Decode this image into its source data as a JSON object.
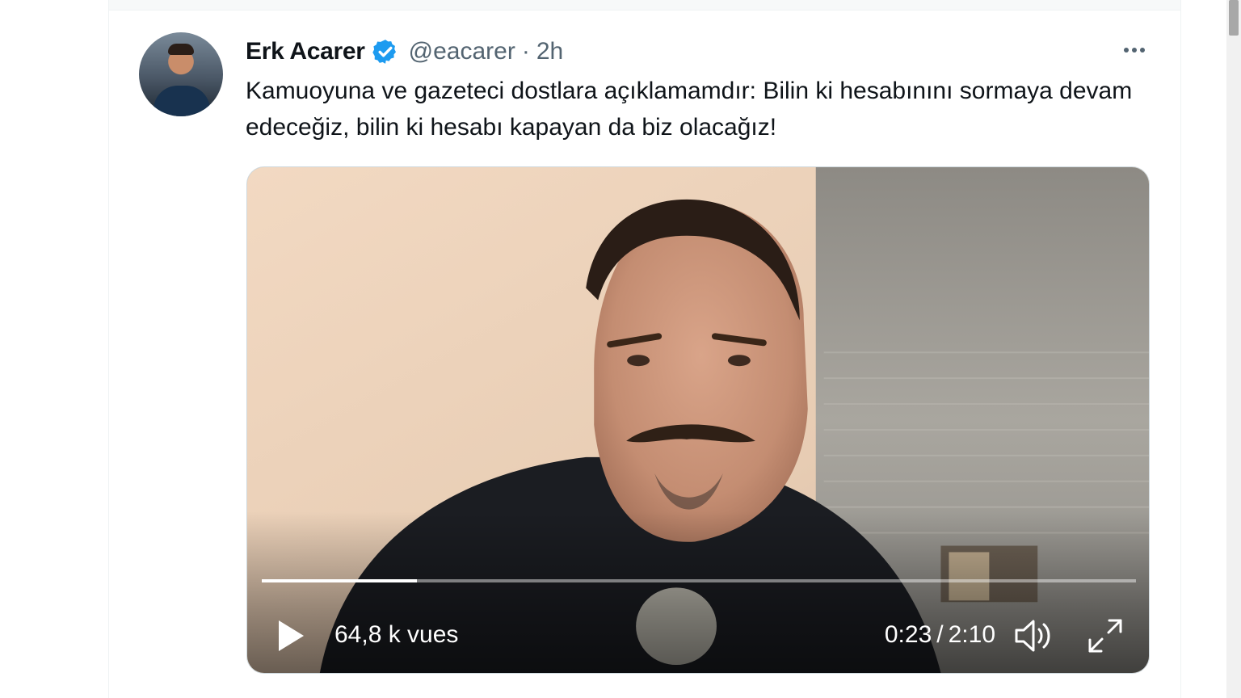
{
  "tweet": {
    "author_name": "Erk Acarer",
    "handle": "@eacarer",
    "separator": "·",
    "timestamp": "2h",
    "text": "Kamuoyuna ve gazeteci dostlara açıklamamdır: Bilin ki hesabınını sormaya devam edeceğiz, bilin ki hesabı kapayan da biz olacağız!",
    "verified_icon": "verified-badge-icon",
    "more_icon": "more-options-icon"
  },
  "video": {
    "views": "64,8 k vues",
    "current_time": "0:23",
    "time_separator": "/",
    "duration": "2:10",
    "progress_fraction": 0.177,
    "play_icon": "play-icon",
    "volume_icon": "volume-icon",
    "fullscreen_icon": "fullscreen-icon"
  },
  "colors": {
    "verified_blue": "#1d9bf0",
    "text_primary": "#0f1419",
    "text_secondary": "#536471"
  }
}
